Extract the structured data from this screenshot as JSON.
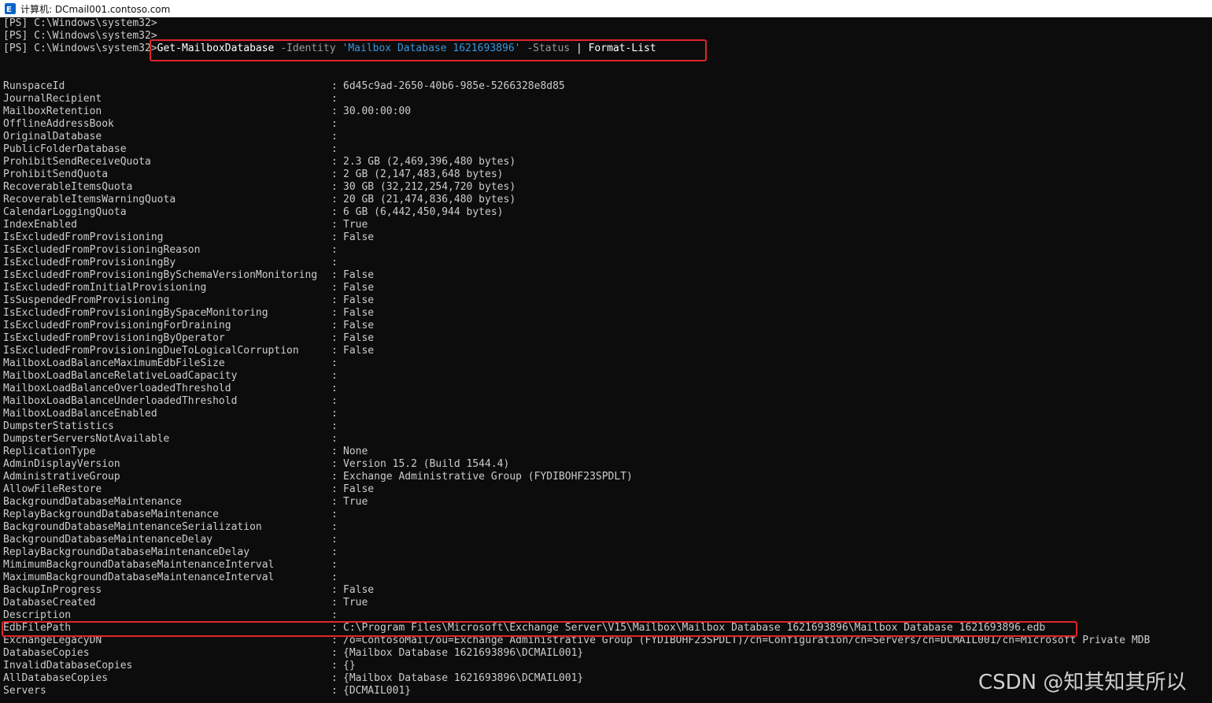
{
  "window": {
    "title": "计算机: DCmail001.contoso.com",
    "icon": "exchange-app-icon"
  },
  "prompts": [
    "[PS] C:\\Windows\\system32>",
    "[PS] C:\\Windows\\system32>",
    "[PS] C:\\Windows\\system32>"
  ],
  "command": {
    "cmdlet": "Get-MailboxDatabase",
    "param1": "-Identity",
    "arg1": "'Mailbox Database 1621693896'",
    "param2": "-Status",
    "pipe": "|",
    "format": "Format-List"
  },
  "properties": [
    {
      "name": "RunspaceId",
      "value": "6d45c9ad-2650-40b6-985e-5266328e8d85"
    },
    {
      "name": "JournalRecipient",
      "value": ""
    },
    {
      "name": "MailboxRetention",
      "value": "30.00:00:00"
    },
    {
      "name": "OfflineAddressBook",
      "value": ""
    },
    {
      "name": "OriginalDatabase",
      "value": ""
    },
    {
      "name": "PublicFolderDatabase",
      "value": ""
    },
    {
      "name": "ProhibitSendReceiveQuota",
      "value": "2.3 GB (2,469,396,480 bytes)"
    },
    {
      "name": "ProhibitSendQuota",
      "value": "2 GB (2,147,483,648 bytes)"
    },
    {
      "name": "RecoverableItemsQuota",
      "value": "30 GB (32,212,254,720 bytes)"
    },
    {
      "name": "RecoverableItemsWarningQuota",
      "value": "20 GB (21,474,836,480 bytes)"
    },
    {
      "name": "CalendarLoggingQuota",
      "value": "6 GB (6,442,450,944 bytes)"
    },
    {
      "name": "IndexEnabled",
      "value": "True"
    },
    {
      "name": "IsExcludedFromProvisioning",
      "value": "False"
    },
    {
      "name": "IsExcludedFromProvisioningReason",
      "value": ""
    },
    {
      "name": "IsExcludedFromProvisioningBy",
      "value": ""
    },
    {
      "name": "IsExcludedFromProvisioningBySchemaVersionMonitoring",
      "value": "False"
    },
    {
      "name": "IsExcludedFromInitialProvisioning",
      "value": "False"
    },
    {
      "name": "IsSuspendedFromProvisioning",
      "value": "False"
    },
    {
      "name": "IsExcludedFromProvisioningBySpaceMonitoring",
      "value": "False"
    },
    {
      "name": "IsExcludedFromProvisioningForDraining",
      "value": "False"
    },
    {
      "name": "IsExcludedFromProvisioningByOperator",
      "value": "False"
    },
    {
      "name": "IsExcludedFromProvisioningDueToLogicalCorruption",
      "value": "False"
    },
    {
      "name": "MailboxLoadBalanceMaximumEdbFileSize",
      "value": ""
    },
    {
      "name": "MailboxLoadBalanceRelativeLoadCapacity",
      "value": ""
    },
    {
      "name": "MailboxLoadBalanceOverloadedThreshold",
      "value": ""
    },
    {
      "name": "MailboxLoadBalanceUnderloadedThreshold",
      "value": ""
    },
    {
      "name": "MailboxLoadBalanceEnabled",
      "value": ""
    },
    {
      "name": "DumpsterStatistics",
      "value": ""
    },
    {
      "name": "DumpsterServersNotAvailable",
      "value": ""
    },
    {
      "name": "ReplicationType",
      "value": "None"
    },
    {
      "name": "AdminDisplayVersion",
      "value": "Version 15.2 (Build 1544.4)"
    },
    {
      "name": "AdministrativeGroup",
      "value": "Exchange Administrative Group (FYDIBOHF23SPDLT)"
    },
    {
      "name": "AllowFileRestore",
      "value": "False"
    },
    {
      "name": "BackgroundDatabaseMaintenance",
      "value": "True"
    },
    {
      "name": "ReplayBackgroundDatabaseMaintenance",
      "value": ""
    },
    {
      "name": "BackgroundDatabaseMaintenanceSerialization",
      "value": ""
    },
    {
      "name": "BackgroundDatabaseMaintenanceDelay",
      "value": ""
    },
    {
      "name": "ReplayBackgroundDatabaseMaintenanceDelay",
      "value": ""
    },
    {
      "name": "MimimumBackgroundDatabaseMaintenanceInterval",
      "value": ""
    },
    {
      "name": "MaximumBackgroundDatabaseMaintenanceInterval",
      "value": ""
    },
    {
      "name": "BackupInProgress",
      "value": "False"
    },
    {
      "name": "DatabaseCreated",
      "value": "True"
    },
    {
      "name": "Description",
      "value": ""
    },
    {
      "name": "EdbFilePath",
      "value": "C:\\Program Files\\Microsoft\\Exchange Server\\V15\\Mailbox\\Mailbox Database 1621693896\\Mailbox Database 1621693896.edb"
    },
    {
      "name": "ExchangeLegacyDN",
      "value": "/o=ContosoMail/ou=Exchange Administrative Group (FYDIBOHF23SPDLT)/cn=Configuration/cn=Servers/cn=DCMAIL001/cn=Microsoft Private MDB"
    },
    {
      "name": "DatabaseCopies",
      "value": "{Mailbox Database 1621693896\\DCMAIL001}"
    },
    {
      "name": "InvalidDatabaseCopies",
      "value": "{}"
    },
    {
      "name": "AllDatabaseCopies",
      "value": "{Mailbox Database 1621693896\\DCMAIL001}"
    },
    {
      "name": "Servers",
      "value": "{DCMAIL001}"
    }
  ],
  "separator": ":",
  "watermark": "CSDN @知其知其所以",
  "colors": {
    "background": "#0c0c0c",
    "text": "#cccccc",
    "parameter": "#9a9a9a",
    "string": "#3a96dd",
    "highlight_box": "#e0262a"
  }
}
